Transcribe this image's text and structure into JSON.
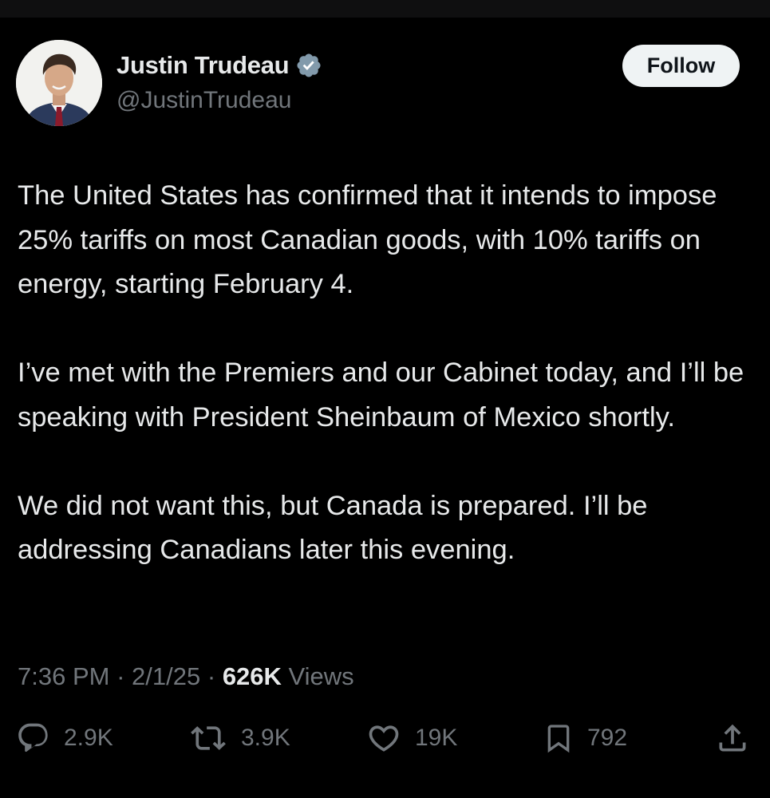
{
  "author": {
    "name": "Justin Trudeau",
    "handle": "@JustinTrudeau",
    "verified_icon": "verified-badge-icon"
  },
  "follow_button": {
    "label": "Follow"
  },
  "tweet": {
    "paragraphs": [
      "The United States has confirmed that it intends to impose 25% tariffs on most Canadian goods, with 10% tariffs on energy, starting February 4.",
      "I’ve met with the Premiers and our Cabinet today, and I’ll be speaking with President Sheinbaum of Mexico shortly.",
      "We did not want this, but Canada is prepared. I’ll be addressing Canadians later this evening."
    ]
  },
  "meta": {
    "time": "7:36 PM",
    "separator": "·",
    "date": "2/1/25",
    "views_count": "626K",
    "views_label": "Views"
  },
  "actions": {
    "replies": "2.9K",
    "reposts": "3.9K",
    "likes": "19K",
    "bookmarks": "792"
  },
  "colors": {
    "background": "#000000",
    "text": "#e7e9ea",
    "secondary": "#71767b",
    "follow_bg": "#eff3f4",
    "verified": "#1d9bf0"
  }
}
